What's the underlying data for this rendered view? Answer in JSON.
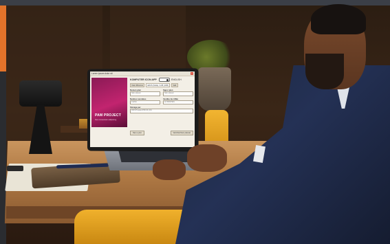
{
  "laptop_app": {
    "window_title": "Lorem ipsum dolor sit",
    "brand": {
      "name": "PAM PROJECT",
      "tagline": "Non consectetur adipiscing"
    },
    "header": {
      "heading": "KOMPUTER ICON APP",
      "toggle_state": "on",
      "language": "ENGLISH"
    },
    "filters": [
      "Nam Rhoncus",
      "ERUS (Nulla) / LCB (I-DB)",
      "Velit"
    ],
    "fields": [
      {
        "label": "Nomen plen",
        "value": "Nam placeat"
      },
      {
        "label": "Sapor plen",
        "value": "Nam placeat"
      },
      {
        "label": "Nuntius iucolatus",
        "value": "C-ENG"
      },
      {
        "label": "Vestibu ita I-DBe",
        "value": "AUTARCHEN"
      }
    ],
    "storage": {
      "label": "Storage per",
      "value": "DR/C/Program/PROJD_001"
    },
    "buttons": {
      "left": "Nam e plet",
      "right": "Varinthat Nam placeat"
    }
  },
  "colors": {
    "accent_orange": "#e3732a",
    "brand_magenta": "#c2246f",
    "chair_yellow": "#f0b12c",
    "suit_navy": "#1d2740"
  }
}
